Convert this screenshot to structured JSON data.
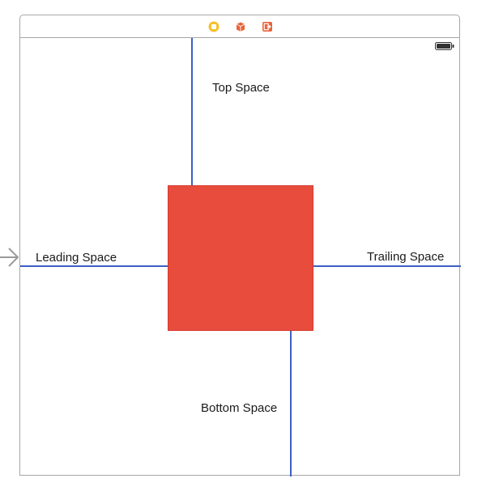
{
  "scene": {
    "dock": {
      "icons": [
        "view-controller-icon",
        "first-responder-icon",
        "exit-icon"
      ]
    },
    "status_bar": {
      "icons": [
        "battery-icon"
      ]
    }
  },
  "constraints": {
    "top_label": "Top Space",
    "leading_label": "Leading Space",
    "trailing_label": "Trailing Space",
    "bottom_label": "Bottom Space"
  },
  "colors": {
    "constraint_line": "#3d5fc4",
    "red_view": "#e74c3c",
    "vc_icon": "#f5c12e",
    "first_responder_icon": "#e8633a",
    "exit_icon": "#e8633a",
    "scene_border": "#a6a6a6"
  }
}
